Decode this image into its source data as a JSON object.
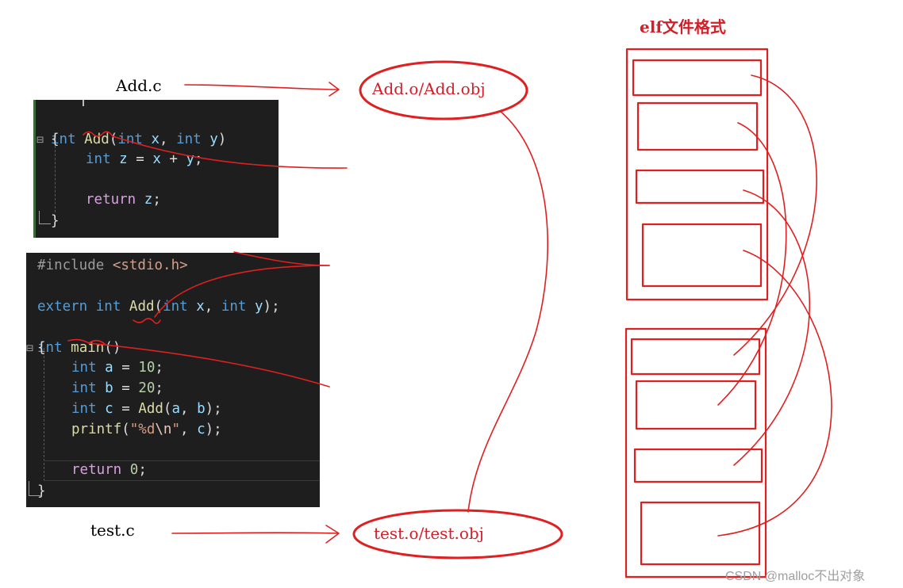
{
  "labels": {
    "add_c": "Add.c",
    "test_c": "test.c",
    "add_obj": "Add.o/Add.obj",
    "test_obj": "test.o/test.obj",
    "elf_title": "elf文件格式",
    "watermark": "CSDN @malloc不出对象"
  },
  "add_code": {
    "l1_kw1": "int",
    "l1_fn": "Add",
    "l1_p1": "(",
    "l1_kw2": "int",
    "l1_var1": " x",
    "l1_p2": ", ",
    "l1_kw3": "int",
    "l1_var2": " y",
    "l1_p3": ")",
    "l2": "{",
    "l3_kw": "int",
    "l3_var1": "z",
    "l3_op1": " = ",
    "l3_var2": "x",
    "l3_op2": " + ",
    "l3_var3": "y",
    "l3_end": ";",
    "l5_kw": "return",
    "l5_var": "z",
    "l5_end": ";",
    "l6": "}"
  },
  "test_code": {
    "l1_pre": "#include ",
    "l1_inc": "<stdio.h>",
    "l3_kw1": "extern",
    "l3_kw2": "int",
    "l3_fn": "Add",
    "l3_p1": "(",
    "l3_kw3": "int",
    "l3_var1": " x",
    "l3_p2": ", ",
    "l3_kw4": "int",
    "l3_var2": " y",
    "l3_p3": ");",
    "l4_kw": "int",
    "l4_fn": "main",
    "l4_p": "()",
    "l5": "{",
    "l6_kw": "int",
    "l6_var": "a",
    "l6_op": " = ",
    "l6_num": "10",
    "l6_end": ";",
    "l7_kw": "int",
    "l7_var": "b",
    "l7_op": " = ",
    "l7_num": "20",
    "l7_end": ";",
    "l8_kw": "int",
    "l8_var": "c",
    "l8_op": " = ",
    "l8_fn": "Add",
    "l8_p1": "(",
    "l8_a": "a",
    "l8_p2": ", ",
    "l8_b": "b",
    "l8_p3": ");",
    "l9_fn": "printf",
    "l9_p1": "(",
    "l9_str1": "\"%d",
    "l9_esc": "\\n",
    "l9_str2": "\"",
    "l9_p2": ", ",
    "l9_var": "c",
    "l9_p3": ");",
    "l11_kw": "return",
    "l11_num": "0",
    "l11_end": ";",
    "l12": "}"
  },
  "colors": {
    "annotation_red": "#e02020",
    "code_background": "#1e1e1e",
    "keyword_blue": "#569cd6",
    "control_pink": "#d8a0df",
    "function_yellow": "#dcdcaa",
    "variable_lightblue": "#9cdcfe",
    "number_green": "#b5cea8",
    "string_orange": "#d69d85"
  }
}
